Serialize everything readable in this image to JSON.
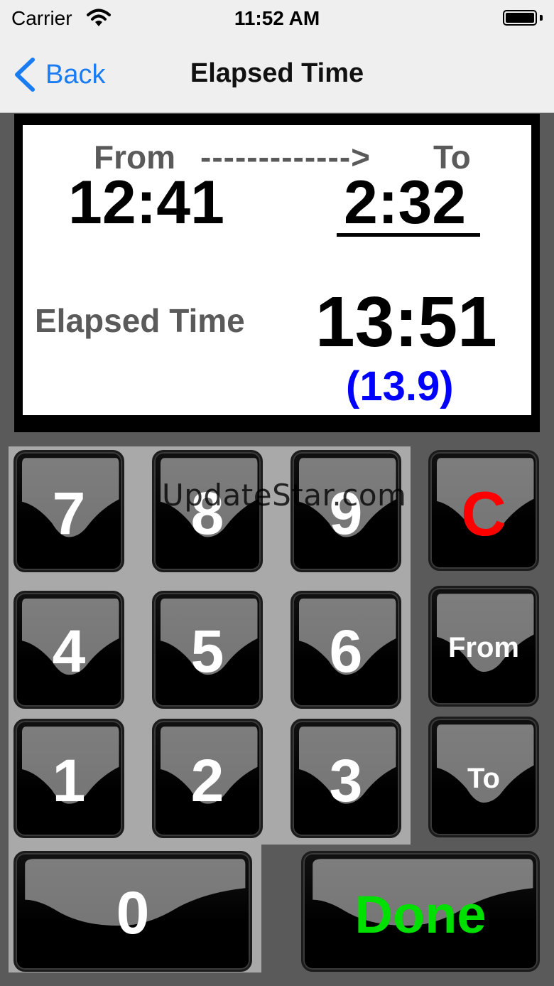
{
  "status_bar": {
    "carrier": "Carrier",
    "time": "11:52 AM"
  },
  "nav": {
    "back_label": "Back",
    "title": "Elapsed Time"
  },
  "display": {
    "from_label": "From",
    "arrow": "------------->",
    "to_label": "To",
    "from_value": "12:41",
    "to_value": "2:32",
    "elapsed_label": "Elapsed Time",
    "elapsed_value": "13:51",
    "elapsed_decimal": "(13.9)"
  },
  "keypad": {
    "k7": "7",
    "k8": "8",
    "k9": "9",
    "k4": "4",
    "k5": "5",
    "k6": "6",
    "k1": "1",
    "k2": "2",
    "k3": "3",
    "k0": "0",
    "clear": "C",
    "from": "From",
    "to": "To",
    "done": "Done"
  },
  "watermark": "UpdateStar.com",
  "colors": {
    "accent": "#1a7cf3",
    "clear": "#ff0000",
    "done": "#00e000",
    "decimal": "#0000ff"
  }
}
